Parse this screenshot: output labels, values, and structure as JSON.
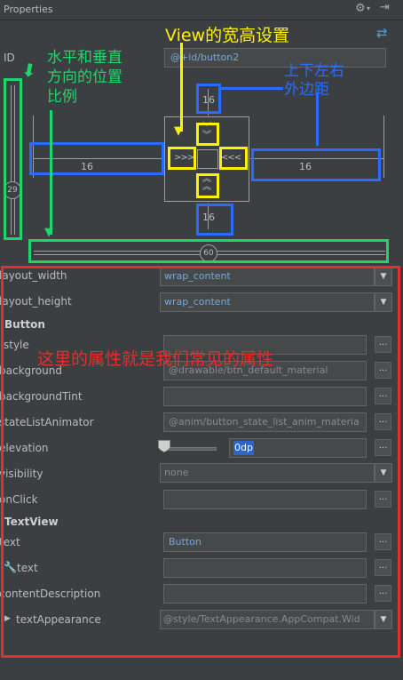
{
  "header": {
    "title": "Properties",
    "gear_icon": "gear-icon",
    "collapse_icon": "collapse-icon"
  },
  "toolbar": {
    "swap_icon": "swap-arrows-icon"
  },
  "id_row": {
    "label": "ID",
    "value": "@+id/button2"
  },
  "constraint": {
    "vertical_bias": "29",
    "horizontal_bias": "60",
    "margin_top": "16",
    "margin_bottom": "16",
    "margin_left": "16",
    "margin_right": "16"
  },
  "properties": {
    "layout_width": {
      "label": "layout_width",
      "value": "wrap_content"
    },
    "layout_height": {
      "label": "layout_height",
      "value": "wrap_content"
    },
    "button_section": "Button",
    "style": {
      "label": "style",
      "value": ""
    },
    "background": {
      "label": "background",
      "value": "@drawable/btn_default_material"
    },
    "backgroundTint": {
      "label": "backgroundTint",
      "value": ""
    },
    "stateListAnimator": {
      "label": "stateListAnimator",
      "value": "@anim/button_state_list_anim_materia"
    },
    "elevation": {
      "label": "elevation",
      "value": "0dp"
    },
    "visibility": {
      "label": "visibility",
      "value": "none"
    },
    "onClick": {
      "label": "onClick",
      "value": ""
    },
    "textview_section": "TextView",
    "text": {
      "label": "text",
      "value": "Button"
    },
    "tools_text": {
      "label": "text",
      "value": ""
    },
    "contentDescription": {
      "label": "contentDescription",
      "value": ""
    },
    "textAppearance": {
      "label": "textAppearance",
      "value": "@style/TextAppearance.AppCompat.Wid"
    }
  },
  "annotations": {
    "green_line1": "水平和垂直",
    "green_line2": "方向的位置",
    "green_line3": "比例",
    "yellow": "View的宽高设置",
    "blue_line1": "上下左右",
    "blue_line2": "外边距",
    "red": "这里的属性就是我们常见的属性"
  },
  "colors": {
    "annotation_green": "#1fd66b",
    "annotation_yellow": "#fff200",
    "annotation_blue": "#2c6bff",
    "annotation_red": "#e52e2e",
    "link_blue": "#7aa7d6"
  }
}
